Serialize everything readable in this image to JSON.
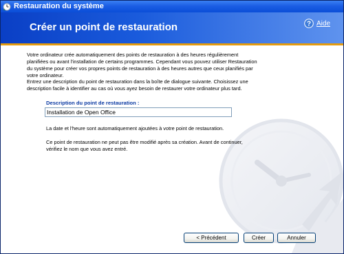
{
  "window": {
    "title": "Restauration du système"
  },
  "header": {
    "heading": "Créer un point de restauration",
    "help_label": "Aide"
  },
  "content": {
    "paragraph1": "Votre ordinateur crée automatiquement des points de restauration à des heures régulièrement planifiées ou avant l'installation de certains programmes. Cependant vous pouvez utiliser Restauration du système pour créer vos propres points de restauration à des heures autres que ceux planifiés par votre ordinateur.",
    "paragraph2": "Entrez une description du point de restauration dans la boîte de dialogue suivante. Choisissez une description facile à identifier au cas où vous ayez besoin de restaurer votre ordinateur plus tard.",
    "description_label": "Description du point de restauration :",
    "description_value": "Installation de Open Office",
    "paragraph3": "La date et l'heure sont automatiquement ajoutées à votre point de restauration.",
    "paragraph4": "Ce point de restauration ne peut pas être modifié après sa création. Avant de continuer, vérifiez le nom que vous avez entré."
  },
  "buttons": {
    "previous": "< Précédent",
    "create": "Créer",
    "cancel": "Annuler"
  },
  "colors": {
    "title_bar": "#1c5ee4",
    "header_blue": "#0a3fc5",
    "accent_orange": "#e59c0f",
    "label_blue": "#0b3aa3"
  },
  "icons": {
    "app": "system-restore-icon",
    "help": "help-icon",
    "watermark": "clock-restore-watermark"
  }
}
